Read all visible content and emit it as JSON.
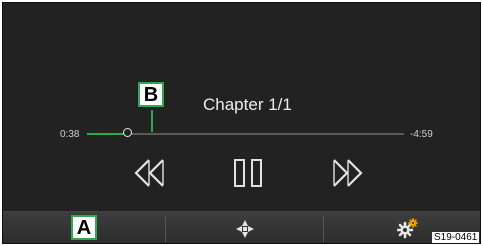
{
  "player": {
    "chapter_label": "Chapter 1/1",
    "time_elapsed": "0:38",
    "time_remaining": "-4:59",
    "progress_fraction": 0.128
  },
  "callouts": {
    "a": "A",
    "b": "B"
  },
  "controls": {
    "rewind_icon": "rewind-icon",
    "pause_icon": "pause-icon",
    "forward_icon": "fast-forward-icon"
  },
  "bottom_bar": {
    "nav_icon": "navigation-icon",
    "settings_icon": "settings-gear-icon"
  },
  "image_code": "S19-0461",
  "colors": {
    "accent": "#2fa84f",
    "background": "#222222",
    "text": "#ededed"
  }
}
